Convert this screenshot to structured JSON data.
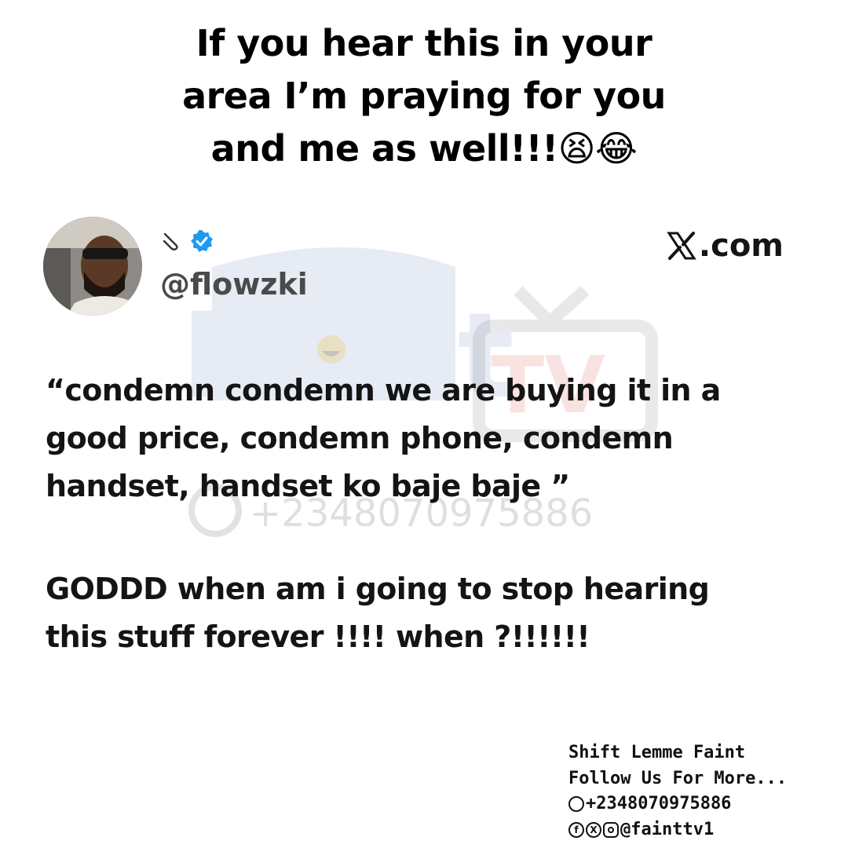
{
  "caption": {
    "line1": "If you hear this in your",
    "line2": "area I’m praying for you",
    "line3": "and me as well!!!😫😂"
  },
  "tweet": {
    "name_emoji": "📎",
    "verified": true,
    "handle": "@flowzki",
    "source": ".com",
    "source_icon": "x-logo-icon",
    "paragraph1": [
      "“condemn condemn we are buying it in a",
      "good price, condemn phone, condemn",
      "handset, handset ko baje baje ”"
    ],
    "paragraph2": [
      "GODDD when am i going to stop hearing",
      "this stuff forever !!!! when ?!!!!!!"
    ]
  },
  "watermark": {
    "brand_faint": "Faint",
    "brand_tv": "TV",
    "phone": "+2348070975886"
  },
  "credits": {
    "line1": "Shift Lemme Faint",
    "line2": "Follow Us For More...",
    "phone": "+2348070975886",
    "social_handle": "@fainttv1",
    "icons": [
      "whatsapp-icon",
      "facebook-icon",
      "x-icon",
      "instagram-icon"
    ]
  },
  "colors": {
    "text": "#141414",
    "handle": "#4a4a4a",
    "verified": "#1d9bf0",
    "watermark_blue": "#3b5fa8",
    "watermark_red": "#d8412f"
  }
}
